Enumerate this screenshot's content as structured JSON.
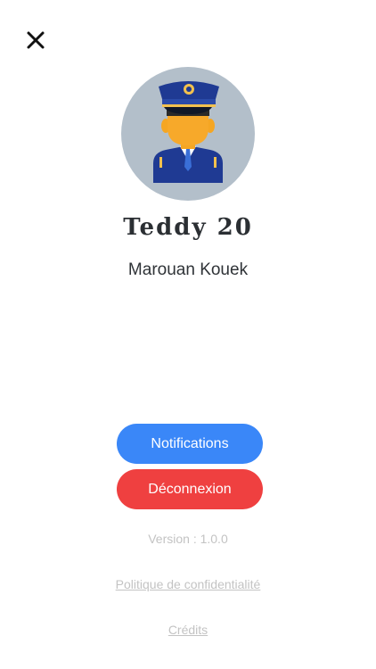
{
  "header": {
    "close_icon": "close-icon"
  },
  "profile": {
    "avatar_icon": "police-officer-avatar",
    "callsign": "Teddy 20",
    "name": "Marouan Kouek"
  },
  "actions": {
    "notifications_label": "Notifications",
    "logout_label": "Déconnexion"
  },
  "footer": {
    "version": "Version : 1.0.0",
    "privacy_link": "Politique de confidentialité",
    "credits_link": "Crédits"
  },
  "colors": {
    "primary_button": "#3a87f8",
    "danger_button": "#ef4040",
    "muted_text": "#c3c3c3",
    "avatar_bg": "#b3bfca"
  }
}
